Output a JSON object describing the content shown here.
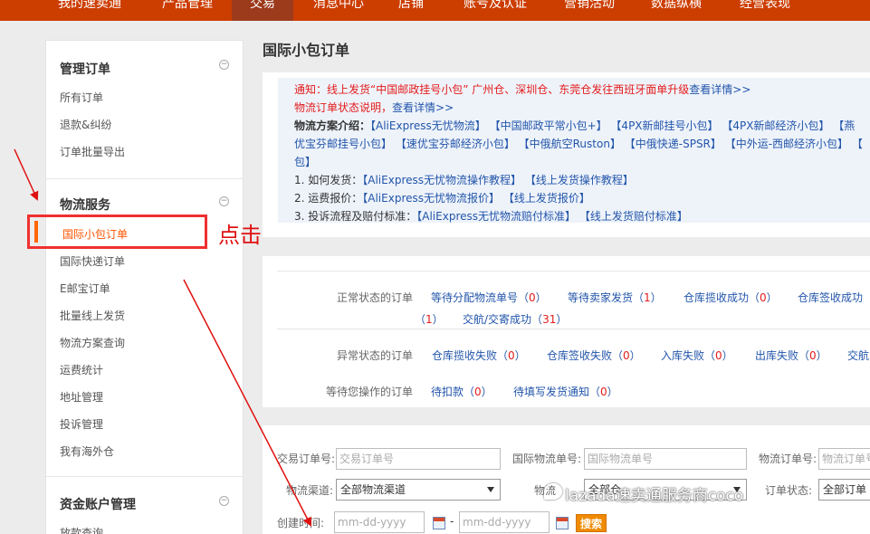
{
  "topnav": {
    "items": [
      "我的速卖通",
      "产品管理",
      "交易",
      "消息中心",
      "店铺",
      "账号及认证",
      "营销活动",
      "数据纵横",
      "经营表现"
    ],
    "active": "交易"
  },
  "sidebar": {
    "sections": [
      {
        "title": "管理订单",
        "collapse_icon": "−",
        "items": [
          "所有订单",
          "退款&纠纷",
          "订单批量导出"
        ]
      },
      {
        "title": "物流服务",
        "collapse_icon": "−",
        "items": [
          "国际小包订单",
          "国际快递订单",
          "E邮宝订单",
          "批量线上发货",
          "物流方案查询",
          "运费统计",
          "地址管理",
          "投诉管理",
          "我有海外仓"
        ]
      },
      {
        "title": "资金账户管理",
        "collapse_icon": "−",
        "items": [
          "放款查询"
        ]
      }
    ],
    "active_item": "国际小包订单"
  },
  "annotation": {
    "click_label": "点击",
    "color": "#e01010"
  },
  "page": {
    "title": "国际小包订单"
  },
  "notice": {
    "line1": "通知：线上发货“中国邮政挂号小包” 广州仓、深圳仓、东莞仓发往西班牙面单升级",
    "line1_link": "查看详情>>",
    "line2_red": "物流订单状态说明，",
    "line2_link": "查看详情>>",
    "plans_label": "物流方案介绍：",
    "plans_row1": "【AliExpress无忧物流】  【中国邮政平常小包+】  【4PX新邮挂号小包】  【4PX新邮经济小包】  【燕",
    "plans_row2": "优宝芬邮挂号小包】  【速优宝芬邮经济小包】  【中俄航空Ruston】  【中俄快递-SPSR】  【中外运-西邮经济小包】  【",
    "plans_row3": "包】",
    "q1_label": "1. 如何发货：",
    "q1_links": "【AliExpress无忧物流操作教程】  【线上发货操作教程】",
    "q2_label": "2. 运费报价：",
    "q2_links": "【AliExpress无忧物流报价】  【线上发货报价】",
    "q3_label": "3. 投诉流程及赔付标准：",
    "q3_links": "【AliExpress无忧物流赔付标准】  【线上发货赔付标准】"
  },
  "status": {
    "normal_label": "正常状态的订单",
    "normal": [
      {
        "name": "等待分配物流单号",
        "count": "0"
      },
      {
        "name": "等待卖家发货",
        "count": "1"
      },
      {
        "name": "仓库揽收成功",
        "count": "0"
      },
      {
        "name": "仓库签收成功",
        "count": ""
      }
    ],
    "normal_wrap_count": "1",
    "handover": {
      "name": "交航/交寄成功",
      "count": "31"
    },
    "abnormal_label": "异常状态的订单",
    "abnormal": [
      {
        "name": "仓库揽收失败",
        "count": "0"
      },
      {
        "name": "仓库签收失败",
        "count": "0"
      },
      {
        "name": "入库失败",
        "count": "0"
      },
      {
        "name": "出库失败",
        "count": "0"
      },
      {
        "name": "交航",
        "count": ""
      }
    ],
    "waiting_label": "等待您操作的订单",
    "waiting": [
      {
        "name": "待扣款",
        "count": "0"
      },
      {
        "name": "待填写发货通知",
        "count": "0"
      }
    ]
  },
  "search": {
    "trade_label": "交易订单号:",
    "trade_placeholder": "交易订单号",
    "intl_label": "国际物流单号:",
    "intl_placeholder": "国际物流单号",
    "logistics_label": "物流订单号:",
    "logistics_placeholder": "物流订单号",
    "channel_label": "物流渠道:",
    "channel_value": "全部物流渠道",
    "logistics2_label": "物流",
    "logistics2_value": "全部仓",
    "order_status_label": "订单状态:",
    "order_status_value": "全部订单",
    "created_label": "创建时间:",
    "date_placeholder": "mm-dd-yyyy",
    "dash": "-",
    "search_button": "搜索"
  },
  "watermark": "lazada速卖通服务商coco"
}
